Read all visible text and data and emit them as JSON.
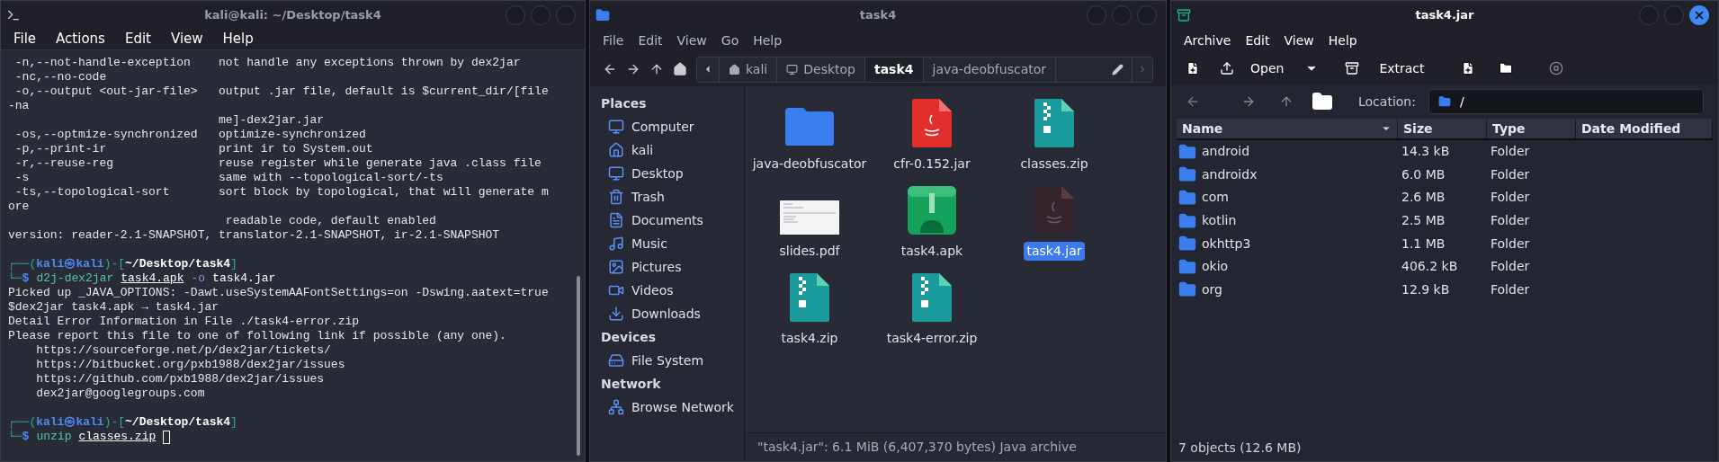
{
  "terminal": {
    "title": "kali@kali: ~/Desktop/task4",
    "active": false,
    "menu": [
      "File",
      "Actions",
      "Edit",
      "View",
      "Help"
    ],
    "lines": [
      {
        "kind": "output",
        "text": " -n,--not-handle-exception    not handle any exceptions thrown by dex2jar"
      },
      {
        "kind": "output",
        "text": " -nc,--no-code"
      },
      {
        "kind": "output",
        "text": " -o,--output <out-jar-file>   output .jar file, default is $current_dir/[file"
      },
      {
        "kind": "output",
        "text": "-na"
      },
      {
        "kind": "output",
        "text": "                              me]-dex2jar.jar"
      },
      {
        "kind": "output",
        "text": " -os,--optmize-synchronized   optimize-synchronized"
      },
      {
        "kind": "output",
        "text": " -p,--print-ir                print ir to System.out"
      },
      {
        "kind": "output",
        "text": " -r,--reuse-reg               reuse register while generate java .class file"
      },
      {
        "kind": "output",
        "text": " -s                           same with --topological-sort/-ts"
      },
      {
        "kind": "output",
        "text": " -ts,--topological-sort       sort block by topological, that will generate m"
      },
      {
        "kind": "output",
        "text": "ore"
      },
      {
        "kind": "output",
        "text": "                               readable code, default enabled"
      },
      {
        "kind": "output",
        "text": "version: reader-2.1-SNAPSHOT, translator-2.1-SNAPSHOT, ir-2.1-SNAPSHOT"
      },
      {
        "kind": "blank"
      },
      {
        "kind": "prompt",
        "open": "┌──(",
        "user": "kali",
        "separator": "㉿",
        "host": "kali",
        "mid": ")-[",
        "path": "~/Desktop/task4",
        "close": "]"
      },
      {
        "kind": "command",
        "prefix": "└─",
        "symbol": "$",
        "cursor": false,
        "tokens": [
          {
            "text": "d2j-dex2jar",
            "kind": "program"
          },
          {
            "text": "task4.apk",
            "kind": "path"
          },
          {
            "text": "-o",
            "kind": "option"
          },
          {
            "text": "task4.jar",
            "kind": "arg"
          }
        ]
      },
      {
        "kind": "output",
        "text": "Picked up _JAVA_OPTIONS: -Dawt.useSystemAAFontSettings=on -Dswing.aatext=true"
      },
      {
        "kind": "output",
        "text": "$dex2jar task4.apk → task4.jar"
      },
      {
        "kind": "output",
        "text": "Detail Error Information in File ./task4-error.zip"
      },
      {
        "kind": "output",
        "text": "Please report this file to one of following link if possible (any one)."
      },
      {
        "kind": "output",
        "text": "    https://sourceforge.net/p/dex2jar/tickets/"
      },
      {
        "kind": "output",
        "text": "    https://bitbucket.org/pxb1988/dex2jar/issues"
      },
      {
        "kind": "output",
        "text": "    https://github.com/pxb1988/dex2jar/issues"
      },
      {
        "kind": "output",
        "text": "    dex2jar@googlegroups.com"
      },
      {
        "kind": "blank"
      },
      {
        "kind": "prompt",
        "open": "┌──(",
        "user": "kali",
        "separator": "㉿",
        "host": "kali",
        "mid": ")-[",
        "path": "~/Desktop/task4",
        "close": "]"
      },
      {
        "kind": "command",
        "prefix": "└─",
        "symbol": "$",
        "cursor": true,
        "tokens": [
          {
            "text": "unzip",
            "kind": "program"
          },
          {
            "text": "classes.zip",
            "kind": "path"
          }
        ]
      }
    ]
  },
  "file_manager": {
    "title": "task4",
    "active": false,
    "menu": [
      "File",
      "Edit",
      "View",
      "Go",
      "Help"
    ],
    "breadcrumb": [
      {
        "label": "kali",
        "kind": "home",
        "selected": false
      },
      {
        "label": "Desktop",
        "kind": "desktop",
        "selected": false
      },
      {
        "label": "task4",
        "kind": "plain",
        "selected": true
      },
      {
        "label": "java-deobfuscator",
        "kind": "plain",
        "selected": false
      }
    ],
    "sidebar": [
      {
        "heading": "Places",
        "items": [
          {
            "label": "Computer",
            "kind": "computer"
          },
          {
            "label": "kali",
            "kind": "home"
          },
          {
            "label": "Desktop",
            "kind": "desktop"
          },
          {
            "label": "Trash",
            "kind": "trash"
          },
          {
            "label": "Documents",
            "kind": "documents"
          },
          {
            "label": "Music",
            "kind": "music"
          },
          {
            "label": "Pictures",
            "kind": "pictures"
          },
          {
            "label": "Videos",
            "kind": "videos"
          },
          {
            "label": "Downloads",
            "kind": "downloads"
          }
        ]
      },
      {
        "heading": "Devices",
        "items": [
          {
            "label": "File System",
            "kind": "drive"
          }
        ]
      },
      {
        "heading": "Network",
        "items": [
          {
            "label": "Browse Network",
            "kind": "network"
          }
        ]
      }
    ],
    "files": [
      {
        "name": "java-deobfuscator",
        "kind": "folder",
        "selected": false
      },
      {
        "name": "cfr-0.152.jar",
        "kind": "jar",
        "selected": false
      },
      {
        "name": "classes.zip",
        "kind": "zip",
        "selected": false
      },
      {
        "name": "slides.pdf",
        "kind": "pdf",
        "selected": false
      },
      {
        "name": "task4.apk",
        "kind": "apk",
        "selected": false
      },
      {
        "name": "task4.jar",
        "kind": "jar",
        "selected": true
      },
      {
        "name": "task4.zip",
        "kind": "zip",
        "selected": false
      },
      {
        "name": "task4-error.zip",
        "kind": "zip",
        "selected": false
      }
    ],
    "status_bar": "\"task4.jar\": 6.1 MiB (6,407,370 bytes) Java archive"
  },
  "archive": {
    "title": "task4.jar",
    "active": true,
    "menu": [
      "Archive",
      "Edit",
      "View",
      "Help"
    ],
    "open_label": "Open",
    "extract_label": "Extract",
    "location_label": "Location:",
    "location": "/",
    "columns": [
      {
        "label": "Name",
        "sorted": true
      },
      {
        "label": "Size",
        "sorted": false
      },
      {
        "label": "Type",
        "sorted": false
      },
      {
        "label": "Date Modified",
        "sorted": false
      }
    ],
    "rows": [
      {
        "name": "android",
        "size": "14.3 kB",
        "type": "Folder"
      },
      {
        "name": "androidx",
        "size": "6.0 MB",
        "type": "Folder"
      },
      {
        "name": "com",
        "size": "2.6 MB",
        "type": "Folder"
      },
      {
        "name": "kotlin",
        "size": "2.5 MB",
        "type": "Folder"
      },
      {
        "name": "okhttp3",
        "size": "1.1 MB",
        "type": "Folder"
      },
      {
        "name": "okio",
        "size": "406.2 kB",
        "type": "Folder"
      },
      {
        "name": "org",
        "size": "12.9 kB",
        "type": "Folder"
      }
    ],
    "status_bar": "7 objects (12.6 MB)"
  }
}
